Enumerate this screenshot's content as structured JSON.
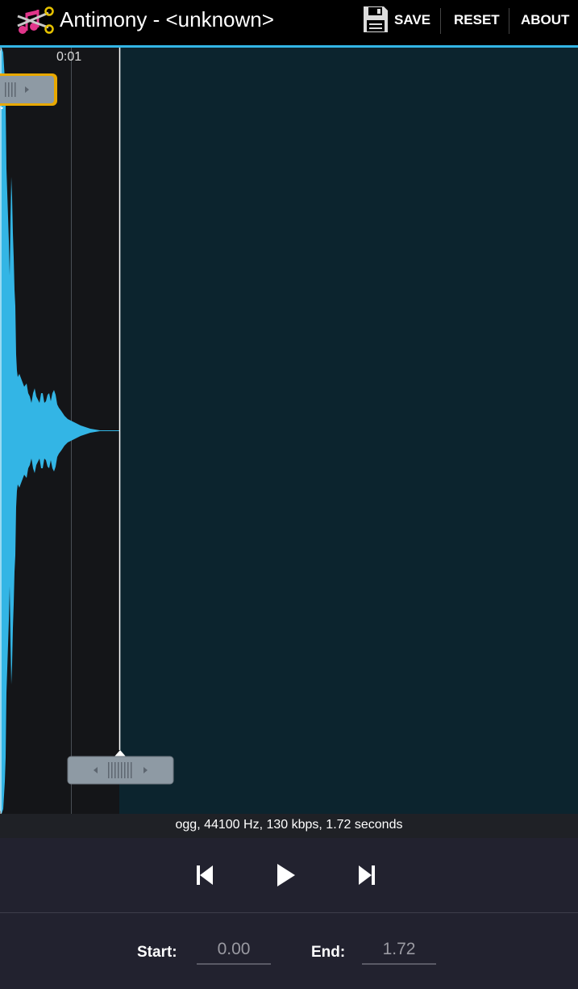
{
  "action_bar": {
    "title": "Antimony - <unknown>",
    "icon": "music-scissors-icon",
    "save_label": "SAVE",
    "reset_label": "RESET",
    "about_label": "ABOUT"
  },
  "waveform": {
    "time_label": "0:01",
    "accent_color": "#33b5e5",
    "background_color": "#0c242e"
  },
  "info": {
    "text": "ogg, 44100 Hz, 130 kbps, 1.72 seconds"
  },
  "transport": {
    "previous_icon": "skip-previous-icon",
    "play_icon": "play-icon",
    "next_icon": "skip-next-icon"
  },
  "selection": {
    "start_label": "Start:",
    "start_value": "0.00",
    "end_label": "End:",
    "end_value": "1.72"
  }
}
